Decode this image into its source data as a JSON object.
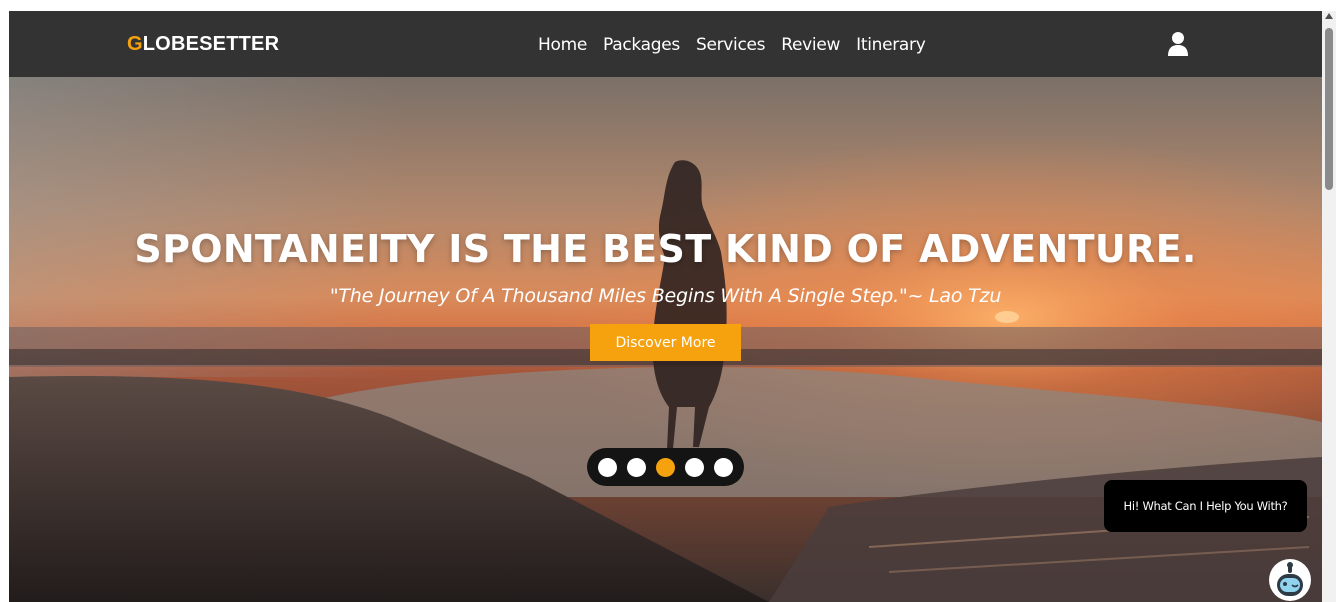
{
  "brand": {
    "first_letter": "G",
    "rest": "LOBESETTER",
    "accent_color": "#f6a10e"
  },
  "nav": {
    "items": [
      {
        "label": "Home"
      },
      {
        "label": "Packages"
      },
      {
        "label": "Services"
      },
      {
        "label": "Review"
      },
      {
        "label": "Itinerary"
      }
    ],
    "user_icon": "user-icon"
  },
  "hero": {
    "title": "SPONTANEITY IS THE BEST KIND OF ADVENTURE.",
    "quote": "\"The Journey Of A Thousand Miles Begins With A Single Step.\"~ Lao Tzu",
    "cta_label": "Discover More",
    "slides_total": 5,
    "active_slide": 3
  },
  "chat": {
    "message": "Hi! What Can I Help You With?",
    "bot_icon": "robot-icon"
  },
  "colors": {
    "navbar_bg": "#333333",
    "accent": "#f6a10e",
    "dots_bg": "#141414"
  }
}
